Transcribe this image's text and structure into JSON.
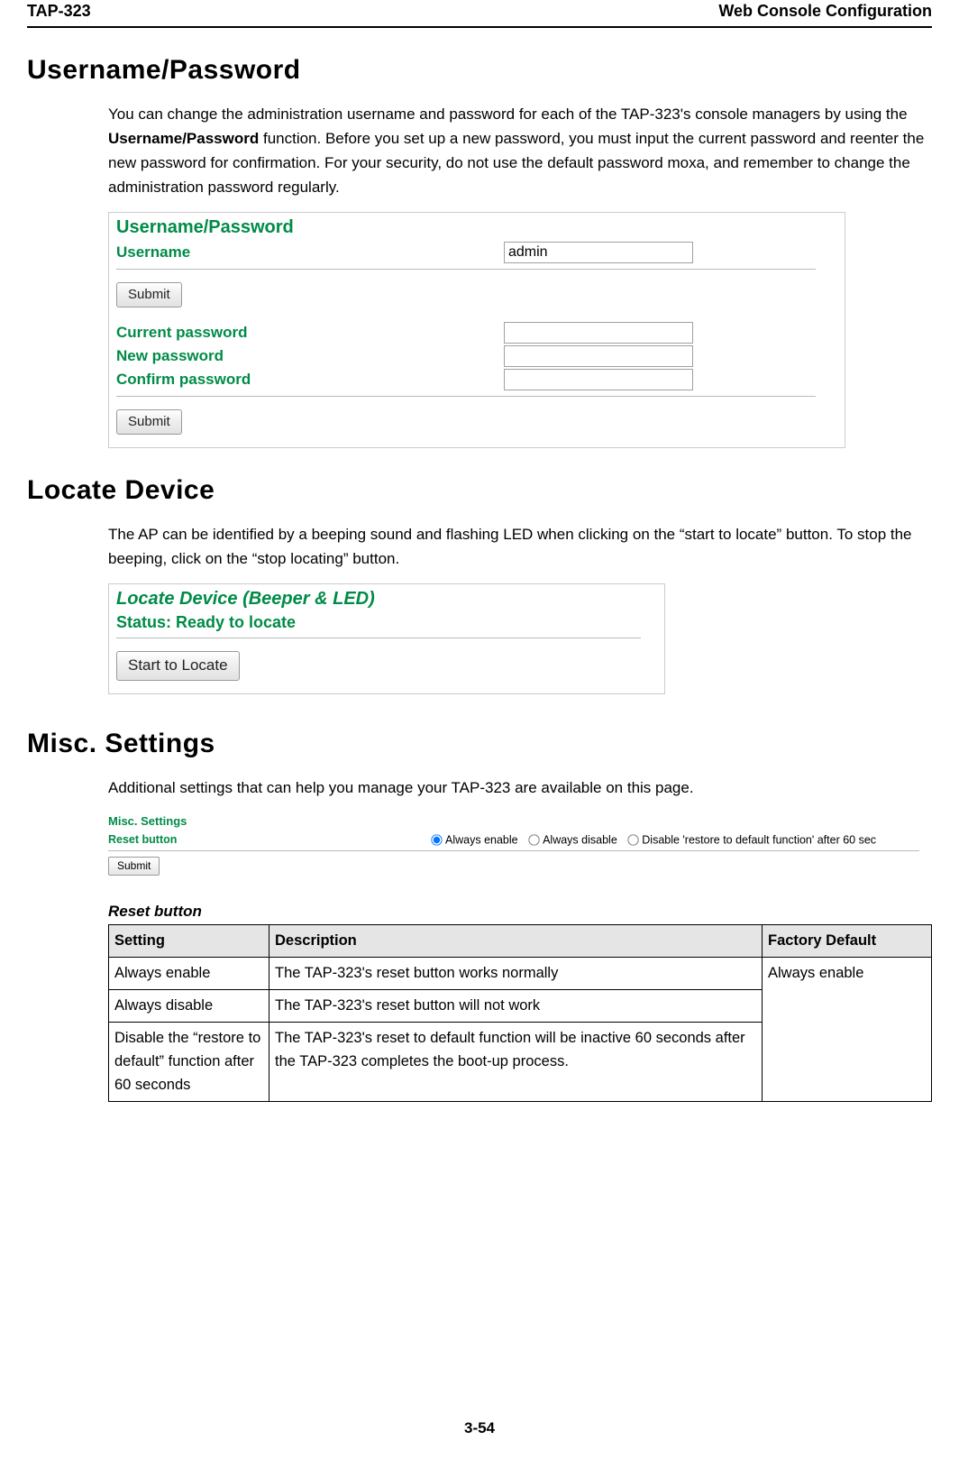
{
  "header": {
    "left": "TAP-323",
    "right": "Web Console Configuration"
  },
  "footer": "3-54",
  "sections": {
    "up": {
      "heading": "Username/Password",
      "para_parts": {
        "p1": "You can change the administration username and password for each of the TAP-323's console managers by using the ",
        "bold": "Username/Password",
        "p2": " function. Before you set up a new password, you must input the current password and reenter the new password for confirmation. For your security, do not use the default password moxa, and remember to change the administration password regularly."
      },
      "ui": {
        "title": "Username/Password",
        "username_label": "Username",
        "username_value": "admin",
        "submit1": "Submit",
        "curpw_label": "Current password",
        "newpw_label": "New password",
        "confpw_label": "Confirm password",
        "submit2": "Submit"
      }
    },
    "locate": {
      "heading": "Locate Device",
      "para": "The AP can be identified by a beeping sound and flashing LED when clicking on the “start to locate” button. To stop the beeping, click on the “stop locating” button.",
      "ui": {
        "title": "Locate Device (Beeper & LED)",
        "status": "Status: Ready to locate",
        "button": "Start to Locate"
      }
    },
    "misc": {
      "heading": "Misc. Settings",
      "para": "Additional settings that can help you manage your TAP-323 are available on this page.",
      "ui": {
        "title": "Misc. Settings",
        "reset_label": "Reset button",
        "opt1": "Always enable",
        "opt2": "Always disable",
        "opt3": "Disable 'restore to default function' after 60 sec",
        "submit": "Submit"
      },
      "table": {
        "caption": "Reset button",
        "head": {
          "c1": "Setting",
          "c2": "Description",
          "c3": "Factory Default"
        },
        "rows": [
          {
            "c1": "Always enable",
            "c2": "The TAP-323's reset button works normally"
          },
          {
            "c1": "Always disable",
            "c2": "The TAP-323's reset button will not work"
          },
          {
            "c1": "Disable the “restore to default” function after 60 seconds",
            "c2": "The TAP-323's reset to default function will be inactive 60 seconds after the TAP-323 completes the boot-up process."
          }
        ],
        "default": "Always enable"
      }
    }
  }
}
